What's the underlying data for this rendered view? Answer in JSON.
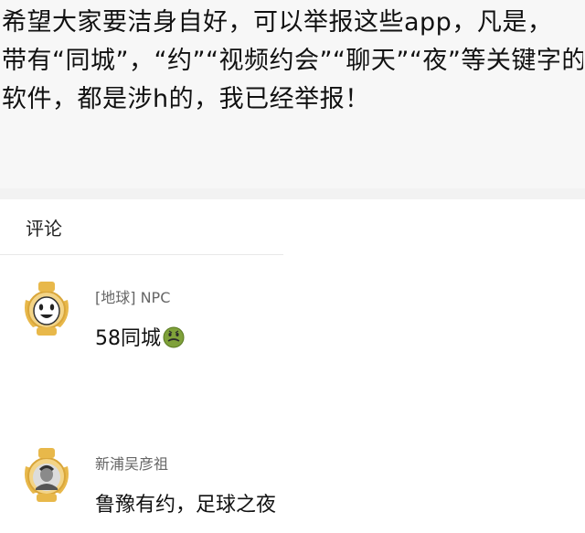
{
  "post": {
    "lines": [
      "希望大家要洁身自好，可以举报这些app，凡是，",
      "带有“同城”，“约”“视频约会”“聊天”“夜”等关键字的",
      "软件，都是涉h的，我已经举报！"
    ]
  },
  "comments_section": {
    "heading": "评论",
    "items": [
      {
        "author": "[地球] NPC",
        "text": "58同城",
        "emoji": "nauseated-face"
      },
      {
        "author": "新浦吴彦祖",
        "text": "鲁豫有约，足球之夜"
      }
    ]
  },
  "colors": {
    "post_background": "#f7f7f7",
    "badge_gold": "#e8b84a",
    "author_gray": "#666666"
  }
}
